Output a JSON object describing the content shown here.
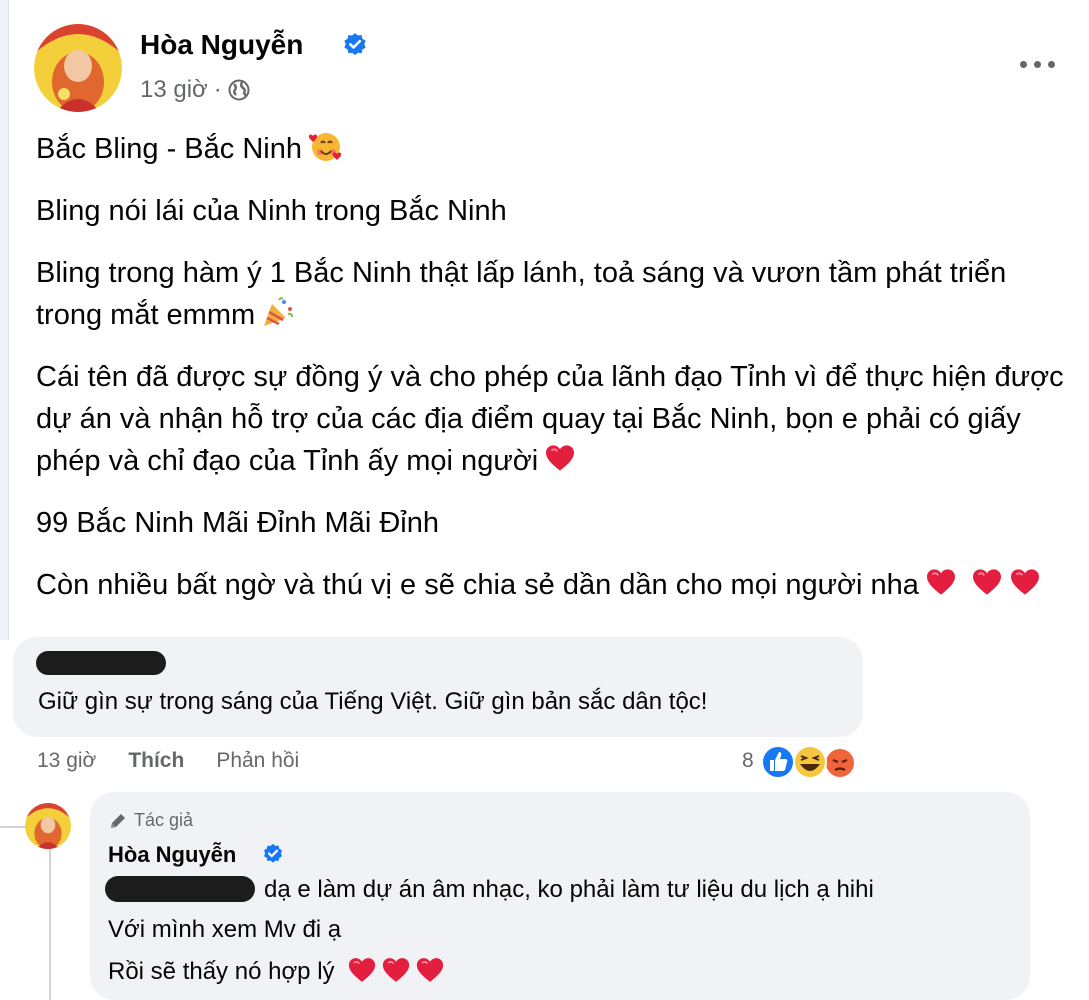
{
  "post": {
    "author": "Hòa Nguyễn",
    "time": "13 giờ",
    "separator": "·",
    "paragraphs": [
      "Bắc Bling - Bắc Ninh",
      "Bling nói lái của Ninh trong Bắc Ninh",
      "Bling trong hàm ý 1 Bắc Ninh thật lấp lánh, toả sáng và vươn tầm phát triển trong mắt emmm",
      "Cái tên đã được sự đồng ý và cho phép của lãnh đạo Tỉnh vì để thực hiện được dự án và nhận hỗ trợ của các địa điểm quay tại Bắc Ninh, bọn e phải có giấy phép và chỉ đạo của Tỉnh ấy mọi người",
      "99 Bắc Ninh Mãi Đỉnh Mãi Đỉnh",
      "Còn nhiều bất ngờ và thú vị e sẽ chia sẻ dần dần cho mọi người nha"
    ]
  },
  "comment": {
    "text": "Giữ gìn sự trong sáng của Tiếng Việt. Giữ gìn bản sắc dân tộc!",
    "time": "13 giờ",
    "like_label": "Thích",
    "reply_label": "Phản hồi",
    "reaction_count": "8"
  },
  "reply": {
    "badge": "Tác giả",
    "author": "Hòa Nguyễn",
    "line1": "dạ e làm dự án âm nhạc, ko phải làm tư liệu du lịch ạ hihi",
    "line2": "Với mình xem Mv đi ạ",
    "line3": "Rồi sẽ thấy nó hợp lý"
  },
  "colors": {
    "verified": "#1877f2",
    "heart": "#e41e3f",
    "secondary_text": "#65676b",
    "bubble_bg": "#f0f2f5"
  },
  "icons": [
    "verified-badge-icon",
    "globe-icon",
    "more-options-icon",
    "heart-eyes-emoji-icon",
    "party-popper-emoji-icon",
    "red-heart-icon",
    "like-reaction-icon",
    "haha-reaction-icon",
    "angry-reaction-icon",
    "pencil-icon"
  ]
}
